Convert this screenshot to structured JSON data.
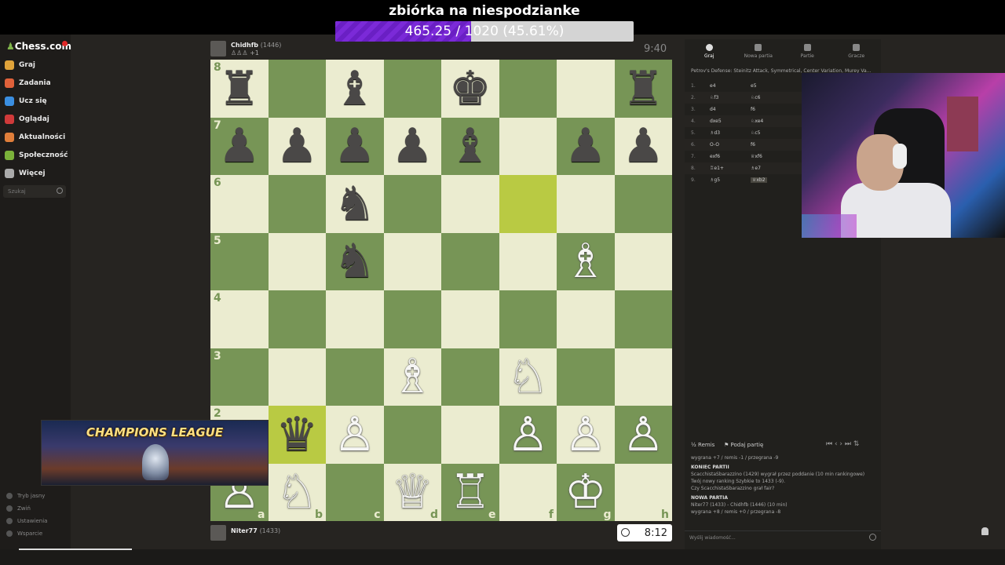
{
  "donation": {
    "title": "zbiórka na niespodzianke",
    "progress_text": "465.25 / 1020 (45.61%)",
    "progress_fraction": 0.4561
  },
  "sidebar": {
    "logo": "Chess.com",
    "items": [
      {
        "label": "Graj",
        "icon": "play-icon",
        "color": "#e0a33a"
      },
      {
        "label": "Zadania",
        "icon": "puzzle-icon",
        "color": "#e0613a"
      },
      {
        "label": "Ucz się",
        "icon": "learn-icon",
        "color": "#3a8ee0"
      },
      {
        "label": "Oglądaj",
        "icon": "watch-icon",
        "color": "#d03a3a"
      },
      {
        "label": "Aktualności",
        "icon": "news-icon",
        "color": "#e07e3a"
      },
      {
        "label": "Społeczność",
        "icon": "community-icon",
        "color": "#7bb23a"
      },
      {
        "label": "Więcej",
        "icon": "more-icon",
        "color": "#aaaaaa"
      }
    ],
    "search_placeholder": "Szukaj",
    "footer": [
      "Tryb jasny",
      "Zwiń",
      "Ustawienia",
      "Wsparcie"
    ]
  },
  "top_player": {
    "name": "Chidhfb",
    "rating": "(1446)",
    "sub": "+1",
    "clock": "9:40"
  },
  "bottom_player": {
    "name": "Niter77",
    "rating": "(1433)",
    "clock": "8:12"
  },
  "board": {
    "ranks": [
      "8",
      "7",
      "6",
      "5",
      "4",
      "3",
      "2",
      "1"
    ],
    "files": [
      "a",
      "b",
      "c",
      "d",
      "e",
      "f",
      "g",
      "h"
    ],
    "pieces": [
      [
        "♜",
        "",
        "♝",
        "",
        "♚",
        "",
        "",
        "♜"
      ],
      [
        "♟",
        "♟",
        "♟",
        "♟",
        "♝",
        "",
        "♟",
        "♟"
      ],
      [
        "",
        "",
        "♞",
        "",
        "",
        "",
        "",
        ""
      ],
      [
        "",
        "",
        "♞",
        "",
        "",
        "",
        "♗",
        ""
      ],
      [
        "",
        "",
        "",
        "",
        "",
        "",
        "",
        ""
      ],
      [
        "",
        "",
        "",
        "♗",
        "",
        "♘",
        "",
        ""
      ],
      [
        "",
        "♛",
        "♙",
        "",
        "",
        "♙",
        "♙",
        "♙"
      ],
      [
        "♙",
        "♘",
        "",
        "♕",
        "♖",
        "",
        "♔",
        ""
      ]
    ],
    "colors": [
      [
        "b",
        "",
        "b",
        "",
        "b",
        "",
        "",
        "b"
      ],
      [
        "b",
        "b",
        "b",
        "b",
        "b",
        "",
        "b",
        "b"
      ],
      [
        "",
        "",
        "b",
        "",
        "",
        "",
        "",
        ""
      ],
      [
        "",
        "",
        "b",
        "",
        "",
        "",
        "w",
        ""
      ],
      [
        "",
        "",
        "",
        "",
        "",
        "",
        "",
        ""
      ],
      [
        "",
        "",
        "",
        "w",
        "",
        "w",
        "",
        ""
      ],
      [
        "",
        "b",
        "w",
        "",
        "",
        "w",
        "w",
        "w"
      ],
      [
        "w",
        "w",
        "",
        "w",
        "w",
        "",
        "w",
        ""
      ]
    ],
    "highlights": [
      [
        2,
        5
      ],
      [
        6,
        1
      ]
    ]
  },
  "overlay_logo": "CHAMPIONS LEAGUE",
  "right_panel": {
    "tabs": [
      "Graj",
      "Nowa partia",
      "Partie",
      "Gracze"
    ],
    "opening": "Petrov's Defense: Steinitz Attack, Symmetrical, Center Variation, Murey Va...",
    "moves": [
      {
        "n": "1.",
        "w": "e4",
        "b": "e5"
      },
      {
        "n": "2.",
        "w": "♘f3",
        "b": "♘c6"
      },
      {
        "n": "3.",
        "w": "d4",
        "b": "f6"
      },
      {
        "n": "4.",
        "w": "dxe5",
        "b": "♘xe4"
      },
      {
        "n": "5.",
        "w": "♗d3",
        "b": "♘c5"
      },
      {
        "n": "6.",
        "w": "O-O",
        "b": "f6"
      },
      {
        "n": "7.",
        "w": "exf6",
        "b": "♕xf6"
      },
      {
        "n": "8.",
        "w": "♖e1+",
        "b": "♗e7"
      },
      {
        "n": "9.",
        "w": "♗g5",
        "b": "♕xb2"
      }
    ],
    "controls": {
      "draw": "Remis",
      "share": "Podaj partię"
    },
    "chat": [
      {
        "type": "t",
        "text": "wygrana +7 / remis -1 / przegrana -9"
      },
      {
        "type": "h",
        "text": "KONIEC PARTII"
      },
      {
        "type": "t",
        "text": "ScacchistaSbarazzino (1429) wygrał przez poddanie (10 min rankingowe)"
      },
      {
        "type": "t",
        "text": "Twój nowy ranking Szybkie to 1433 (-9)."
      },
      {
        "type": "t",
        "text": "Czy ScacchistaSbarazzino grał fair?"
      },
      {
        "type": "h",
        "text": "NOWA PARTIA"
      },
      {
        "type": "t",
        "text": "Niter77 (1433) - Chidhfb (1446) (10 min)"
      },
      {
        "type": "t",
        "text": "wygrana +8 / remis +0 / przegrana -8"
      }
    ],
    "chat_placeholder": "Wyślij wiadomość..."
  }
}
